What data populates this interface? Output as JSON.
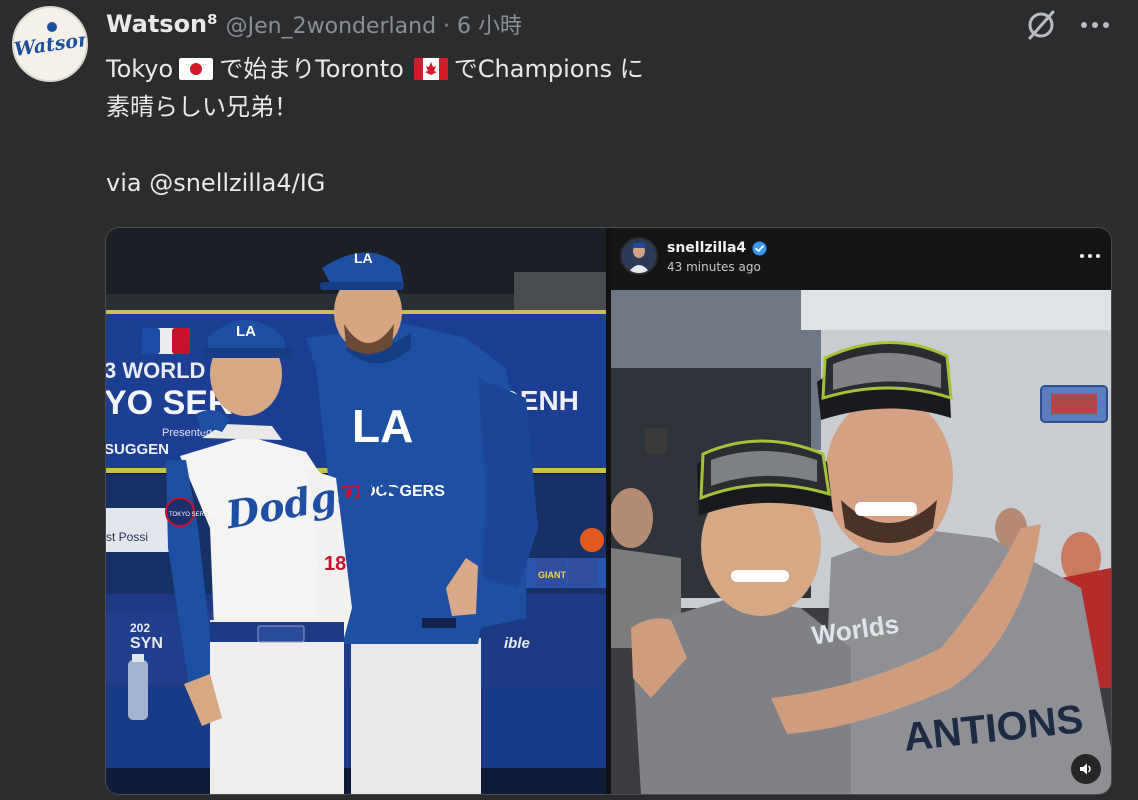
{
  "post": {
    "author_name": "Watson⁸",
    "author_handle": "@Jen_2wonderland · 6 小時",
    "avatar_text": "Watson",
    "text_line1_a": "Tokyo",
    "text_line1_b": "で始まりToronto",
    "text_line1_c": "でChampions に",
    "text_line2": "素晴らしい兄弟！",
    "text_line3": "via @snellzilla4/IG"
  },
  "icons": {
    "grok": "slashed-circle-icon",
    "more": "more-dots-icon",
    "flag_japan": "japan-flag-icon",
    "flag_canada": "canada-flag-icon",
    "verified": "verified-badge-icon",
    "sound": "speaker-icon"
  },
  "media": {
    "left_photo": {
      "banner_line1": "3 WORLD TOUR",
      "banner_line2": "YO SER",
      "banner_presented": "Presented",
      "banner_sponsor": "SUGGEN",
      "banner_right": "GENH",
      "jersey_left": "Dodgers",
      "jersey_number": "18",
      "hoodie_logo": "LA",
      "hoodie_text": "DODGERS",
      "cap_logo": "LA",
      "sign_left": "st Possi",
      "sign_bottom": "SYN",
      "sign_bottom_year": "202",
      "sign_ible": "ible",
      "patch": "TOKYO SERIES",
      "snack_label": "GIANT"
    },
    "right_photo": {
      "ig_username": "snellzilla4",
      "ig_time": "43 minutes ago",
      "shirt_text1": "Worlds",
      "shirt_text2": "ANTIONS"
    }
  },
  "colors": {
    "background": "#2b2c2e",
    "text": "#e7e9ea",
    "muted": "#8b8f94",
    "dodger_blue": "#1e4fa3",
    "verified_blue": "#3897f0"
  }
}
